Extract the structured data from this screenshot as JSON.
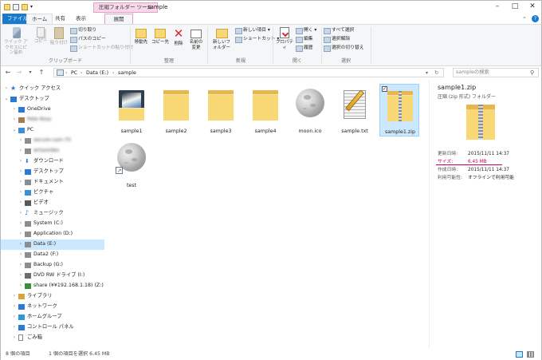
{
  "window": {
    "title": "sample",
    "contextual_tab_title": "圧縮フォルダー ツール"
  },
  "ribbon_tabs": [
    "ファイル",
    "ホーム",
    "共有",
    "表示",
    "展開"
  ],
  "ribbon": {
    "clipboard": {
      "label": "クリップボード",
      "pin": "クイック アクセスにピン留め",
      "copy": "コピー",
      "paste": "貼り付け",
      "cut": "切り取り",
      "copy_path": "パスのコピー",
      "paste_shortcut": "ショートカットの貼り付け"
    },
    "organize": {
      "label": "整理",
      "move_to": "移動先",
      "copy_to": "コピー先",
      "delete": "削除",
      "rename": "名前の変更"
    },
    "new": {
      "label": "新規",
      "new_folder": "新しいフォルダー",
      "new_item": "新しい項目 ▾",
      "shortcut": "ショートカット ▾"
    },
    "open": {
      "label": "開く",
      "properties": "プロパティ",
      "open": "開く ▾",
      "edit": "編集",
      "history": "履歴"
    },
    "select": {
      "label": "選択",
      "select_all": "すべて選択",
      "select_none": "選択解除",
      "invert": "選択の切り替え"
    }
  },
  "address": {
    "path": [
      "PC",
      "Data (E:)",
      "sample"
    ],
    "search_placeholder": "sampleの検索"
  },
  "nav": [
    {
      "label": "クイック アクセス",
      "level": 0,
      "icon": "star-icon",
      "color": "#2b7ad6"
    },
    {
      "label": "デスクトップ",
      "level": 0,
      "icon": "desktop-icon",
      "color": "#2b7ad6",
      "expanded": true
    },
    {
      "label": "OneDrive",
      "level": 1,
      "icon": "cloud-icon",
      "color": "#2b7ad6"
    },
    {
      "label": "Pete Ross",
      "level": 1,
      "icon": "user-icon",
      "color": "#a57c4f",
      "blurred": true
    },
    {
      "label": "PC",
      "level": 1,
      "icon": "pc-icon",
      "color": "#3d8fd6",
      "expanded": true
    },
    {
      "label": "secure-cam-70",
      "level": 2,
      "icon": "drive-icon",
      "color": "#8d8d8d",
      "blurred": true
    },
    {
      "label": "wrtaxiides",
      "level": 2,
      "icon": "drive-icon",
      "color": "#8d8d8d",
      "blurred": true
    },
    {
      "label": "ダウンロード",
      "level": 2,
      "icon": "download-icon",
      "color": "#2b7ad6"
    },
    {
      "label": "デスクトップ",
      "level": 2,
      "icon": "desktop-icon",
      "color": "#2b7ad6"
    },
    {
      "label": "ドキュメント",
      "level": 2,
      "icon": "document-icon",
      "color": "#8d8d8d"
    },
    {
      "label": "ピクチャ",
      "level": 2,
      "icon": "picture-icon",
      "color": "#3d8fd6"
    },
    {
      "label": "ビデオ",
      "level": 2,
      "icon": "video-icon",
      "color": "#5a5a5a"
    },
    {
      "label": "ミュージック",
      "level": 2,
      "icon": "music-icon",
      "color": "#2b7ad6"
    },
    {
      "label": "System (C:)",
      "level": 2,
      "icon": "drive-icon",
      "color": "#8d8d8d"
    },
    {
      "label": "Application (D:)",
      "level": 2,
      "icon": "drive-icon",
      "color": "#8d8d8d"
    },
    {
      "label": "Data (E:)",
      "level": 2,
      "icon": "drive-icon",
      "color": "#8d8d8d",
      "selected": true
    },
    {
      "label": "Data2 (F:)",
      "level": 2,
      "icon": "drive-icon",
      "color": "#8d8d8d"
    },
    {
      "label": "Backup (G:)",
      "level": 2,
      "icon": "drive-icon",
      "color": "#8d8d8d"
    },
    {
      "label": "DVD RW ドライブ (I:)",
      "level": 2,
      "icon": "dvd-icon",
      "color": "#6d6d6d"
    },
    {
      "label": "share (¥¥192.168.1.18) (Z:)",
      "level": 2,
      "icon": "network-drive-icon",
      "color": "#3a8f3a"
    },
    {
      "label": "ライブラリ",
      "level": 1,
      "icon": "library-icon",
      "color": "#d9a43a"
    },
    {
      "label": "ネットワーク",
      "level": 1,
      "icon": "network-icon",
      "color": "#2b7ad6"
    },
    {
      "label": "ホームグループ",
      "level": 1,
      "icon": "homegroup-icon",
      "color": "#2b9ad6"
    },
    {
      "label": "コントロール パネル",
      "level": 1,
      "icon": "control-panel-icon",
      "color": "#2b7ad6"
    },
    {
      "label": "ごみ箱",
      "level": 1,
      "icon": "recycle-bin-icon",
      "color": "#8d8d8d"
    }
  ],
  "files": [
    {
      "name": "sample1",
      "kind": "folder-thumbs"
    },
    {
      "name": "sample2",
      "kind": "folder"
    },
    {
      "name": "sample3",
      "kind": "folder"
    },
    {
      "name": "sample4",
      "kind": "folder"
    },
    {
      "name": "moon.ico",
      "kind": "moon"
    },
    {
      "name": "sample.txt",
      "kind": "text"
    },
    {
      "name": "sample1.zip",
      "kind": "zip",
      "selected": true
    },
    {
      "name": "test",
      "kind": "moon-shortcut"
    }
  ],
  "details": {
    "file_name": "sample1.zip",
    "file_type": "圧縮 (zip 形式) フォルダー",
    "rows": [
      {
        "key": "更新日時:",
        "value": "2015/11/11 14:37"
      },
      {
        "key": "サイズ:",
        "value": "6.45 MB",
        "highlight": true
      },
      {
        "key": "作成日時:",
        "value": "2015/11/11 14:37"
      },
      {
        "key": "利用可能性:",
        "value": "オフラインで利用可能"
      }
    ],
    "highlight_color": "#c8005a"
  },
  "status": {
    "item_count": "8 個の項目",
    "selection": "1 個の項目を選択  6.45 MB"
  },
  "colors": {
    "accent": "#1979ca",
    "selection": "#cce8ff",
    "contextual_tab": "#f9d7ea"
  }
}
